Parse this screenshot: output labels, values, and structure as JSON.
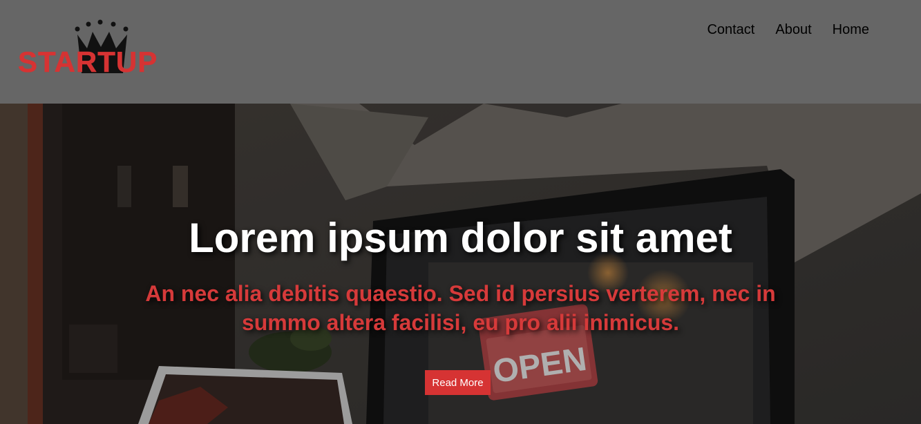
{
  "logo": {
    "text": "STARTUP",
    "color": "#d63333",
    "crown_color": "#111111"
  },
  "nav": {
    "items": [
      {
        "label": "Contact"
      },
      {
        "label": "About"
      },
      {
        "label": "Home"
      }
    ]
  },
  "hero": {
    "title": "Lorem ipsum dolor sit amet",
    "subtitle": "An nec alia debitis quaestio. Sed id persius verterem, nec in summo altera facilisi, eu pro alii inimicus.",
    "button_label": "Read More",
    "sign_text": "OPEN",
    "accent_color": "#d63333"
  }
}
